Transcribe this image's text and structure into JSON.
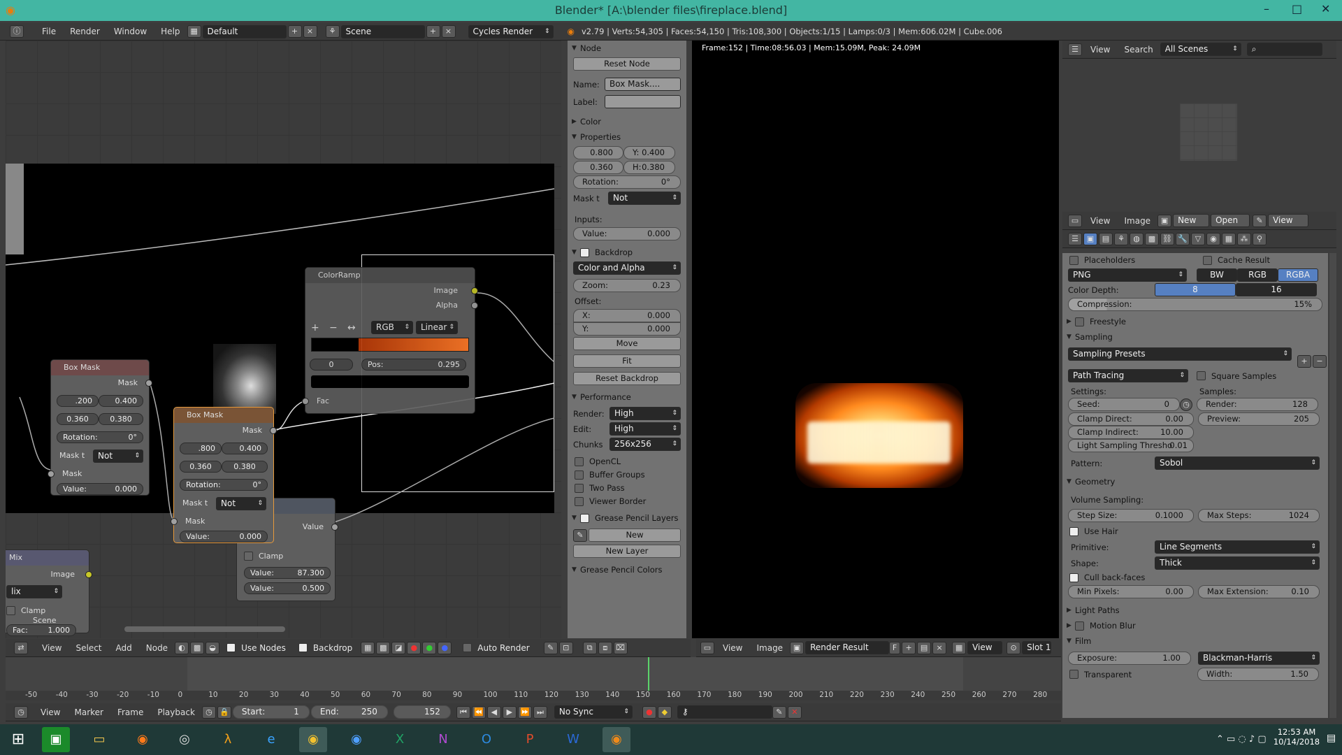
{
  "window": {
    "title": "Blender* [A:\\blender files\\fireplace.blend]",
    "controls": [
      "–",
      "□",
      "✕"
    ]
  },
  "topbar": {
    "menus": [
      "File",
      "Render",
      "Window",
      "Help"
    ],
    "layout": "Default",
    "scene": "Scene",
    "engine": "Cycles Render",
    "stats": "v2.79 | Verts:54,305 | Faces:54,150 | Tris:108,300 | Objects:1/15 | Lamps:0/3 | Mem:606.02M | Cube.006"
  },
  "nodes": {
    "colorramp": {
      "title": "ColorRamp",
      "out_image": "Image",
      "out_alpha": "Alpha",
      "mode": "RGB",
      "interp": "Linear",
      "index": "0",
      "pos_label": "Pos:",
      "pos": "0.295",
      "in_fac": "Fac",
      "plus": "+",
      "minus": "−",
      "flip": "↔"
    },
    "boxmask1": {
      "title": "Box Mask",
      "out": "Mask",
      "x": ".200",
      "y": "0.400",
      "w": "0.360",
      "h": "0.380",
      "rot": "Rotation:",
      "rot_val": "0°",
      "mask_t": "Mask t",
      "mask_t_val": "Not",
      "in_mask": "Mask",
      "value_label": "Value:",
      "value": "0.000"
    },
    "boxmask2": {
      "title": "Box Mask",
      "out": "Mask",
      "x": ".800",
      "y": "0.400",
      "w": "0.360",
      "h": "0.380",
      "rot": "Rotation:",
      "rot_val": "0°",
      "mask_t": "Mask t",
      "mask_t_val": "Not",
      "in_mask": "Mask",
      "value_label": "Value:",
      "value": "0.000"
    },
    "mathnode": {
      "out": "Value",
      "clamp": "Clamp",
      "v1_label": "Value:",
      "v1": "87.300",
      "v2_label": "Value:",
      "v2": "0.500"
    },
    "mix": {
      "title": "Mix",
      "out": "Image",
      "mode": "lix",
      "clamp": "Clamp",
      "scene": "Scene",
      "fac": "Fac:",
      "fac_val": "1.000"
    }
  },
  "node_header": {
    "items": [
      "View",
      "Select",
      "Add",
      "Node"
    ],
    "use_nodes": "Use Nodes",
    "backdrop": "Backdrop",
    "auto_render": "Auto Render"
  },
  "props": {
    "node": "Node",
    "reset_node": "Reset Node",
    "name_label": "Name:",
    "name_val": "Box Mask....",
    "label_label": "Label:",
    "color": "Color",
    "properties": "Properties",
    "x": "0.800",
    "y_label": "Y:",
    "y": "0.400",
    "w": "0.360",
    "h_label": "H:",
    "h": "0.380",
    "rotation_label": "Rotation:",
    "rotation": "0°",
    "mask_t": "Mask t",
    "mask_t_val": "Not",
    "inputs": "Inputs:",
    "value_label": "Value:",
    "value": "0.000",
    "backdrop": "Backdrop",
    "channels": "Color and Alpha",
    "zoom_label": "Zoom:",
    "zoom": "0.23",
    "offset": "Offset:",
    "offx_label": "X:",
    "offx": "0.000",
    "offy_label": "Y:",
    "offy": "0.000",
    "move": "Move",
    "fit": "Fit",
    "reset_backdrop": "Reset Backdrop",
    "performance": "Performance",
    "render_label": "Render:",
    "render_val": "High",
    "edit_label": "Edit:",
    "edit_val": "High",
    "chunks_label": "Chunks",
    "chunks_val": "256x256",
    "opencl": "OpenCL",
    "buffer_groups": "Buffer Groups",
    "two_pass": "Two Pass",
    "viewer_border": "Viewer Border",
    "grease_layers": "Grease Pencil Layers",
    "new": "New",
    "new_layer": "New Layer",
    "grease_colors": "Grease Pencil Colors"
  },
  "render_view": {
    "info": "Frame:152 | Time:08:56.03 | Mem:15.09M, Peak: 24.09M",
    "header_items": [
      "View",
      "Image"
    ],
    "result": "Render Result",
    "f": "F",
    "view": "View",
    "slot": "Slot 1"
  },
  "outliner": {
    "items": [
      "View",
      "Search"
    ],
    "scenes": "All Scenes"
  },
  "image_editor_header": {
    "items": [
      "View",
      "Image"
    ],
    "new": "New",
    "open": "Open",
    "view": "View"
  },
  "render_props": {
    "placeholders": "Placeholders",
    "cache_result": "Cache Result",
    "format": "PNG",
    "bw": "BW",
    "rgb": "RGB",
    "rgba": "RGBA",
    "color_depth": "Color Depth:",
    "depth8": "8",
    "depth16": "16",
    "compression": "Compression:",
    "compression_val": "15%",
    "freestyle": "Freestyle",
    "sampling": "Sampling",
    "sampling_presets": "Sampling Presets",
    "path_tracing": "Path Tracing",
    "square_samples": "Square Samples",
    "settings": "Settings:",
    "samples": "Samples:",
    "seed": "Seed:",
    "seed_val": "0",
    "render": "Render:",
    "render_val": "128",
    "clamp_direct": "Clamp Direct:",
    "clamp_direct_val": "0.00",
    "preview": "Preview:",
    "preview_val": "205",
    "clamp_indirect": "Clamp Indirect:",
    "clamp_indirect_val": "10.00",
    "light_thresh": "Light Sampling Thresho",
    "light_thresh_val": "0.01",
    "pattern": "Pattern:",
    "pattern_val": "Sobol",
    "geometry": "Geometry",
    "volume_sampling": "Volume Sampling:",
    "step_size": "Step Size:",
    "step_size_val": "0.1000",
    "max_steps": "Max Steps:",
    "max_steps_val": "1024",
    "use_hair": "Use Hair",
    "primitive": "Primitive:",
    "primitive_val": "Line Segments",
    "shape": "Shape:",
    "shape_val": "Thick",
    "cull": "Cull back-faces",
    "min_pixels": "Min Pixels:",
    "min_pixels_val": "0.00",
    "max_ext": "Max Extension:",
    "max_ext_val": "0.10",
    "light_paths": "Light Paths",
    "motion_blur": "Motion Blur",
    "film": "Film",
    "exposure": "Exposure:",
    "exposure_val": "1.00",
    "filter": "Blackman-Harris",
    "transparent": "Transparent",
    "width": "Width:",
    "width_val": "1.50"
  },
  "timeline": {
    "ruler": [
      "-50",
      "-40",
      "-30",
      "-20",
      "-10",
      "0",
      "10",
      "20",
      "30",
      "40",
      "50",
      "60",
      "70",
      "80",
      "90",
      "100",
      "110",
      "120",
      "130",
      "140",
      "150",
      "160",
      "170",
      "180",
      "190",
      "200",
      "210",
      "220",
      "230",
      "240",
      "250",
      "260",
      "270",
      "280"
    ],
    "items": [
      "View",
      "Marker",
      "Frame",
      "Playback"
    ],
    "start_label": "Start:",
    "start": "1",
    "end_label": "End:",
    "end": "250",
    "current": "152",
    "sync": "No Sync",
    "current_frame": 152
  },
  "taskbar": {
    "time": "12:53 AM",
    "date": "10/14/2018"
  },
  "colors": {
    "title": "#43b6a3",
    "accent": "#5680c2",
    "fire": "#ff8a1e"
  }
}
